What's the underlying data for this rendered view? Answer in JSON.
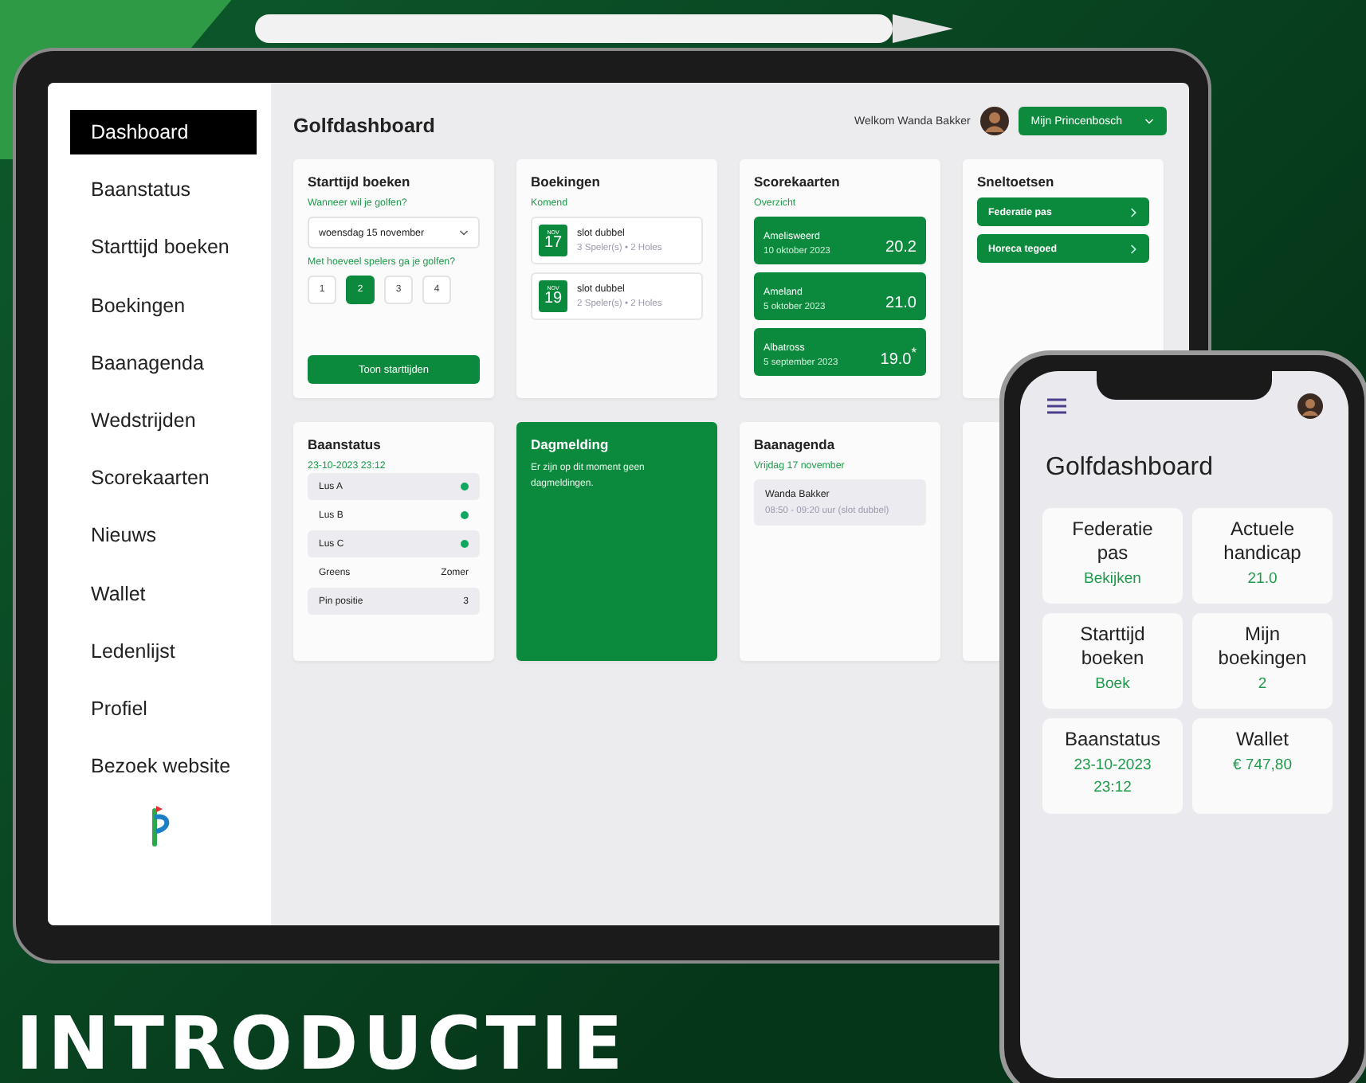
{
  "tablet": {
    "sidebar": {
      "items": [
        {
          "label": "Dashboard",
          "selected": true
        },
        {
          "label": "Baanstatus",
          "selected": false
        },
        {
          "label": "Starttijd boeken",
          "selected": false
        },
        {
          "label": "Boekingen",
          "selected": false
        },
        {
          "label": "Baanagenda",
          "selected": false
        },
        {
          "label": "Wedstrijden",
          "selected": false
        },
        {
          "label": "Scorekaarten",
          "selected": false
        },
        {
          "label": "Nieuws",
          "selected": false
        },
        {
          "label": "Wallet",
          "selected": false
        },
        {
          "label": "Ledenlijst",
          "selected": false
        },
        {
          "label": "Profiel",
          "selected": false
        },
        {
          "label": "Bezoek website",
          "selected": false
        }
      ]
    },
    "header": {
      "title": "Golfdashboard",
      "welcome": "Welkom Wanda Bakker",
      "club_button": "Mijn Princenbosch"
    },
    "starttijd": {
      "title": "Starttijd boeken",
      "question_date": "Wanneer wil je golfen?",
      "date_value": "woensdag 15 november",
      "question_players": "Met hoeveel spelers ga je golfen?",
      "players": [
        {
          "label": "1",
          "selected": false
        },
        {
          "label": "2",
          "selected": true
        },
        {
          "label": "3",
          "selected": false
        },
        {
          "label": "4",
          "selected": false
        }
      ],
      "button": "Toon starttijden"
    },
    "boekingen": {
      "title": "Boekingen",
      "subtitle": "Komend",
      "items": [
        {
          "month": "NOV",
          "day": "17",
          "name": "slot dubbel",
          "details": "3 Speler(s) • 2 Holes"
        },
        {
          "month": "NOV",
          "day": "19",
          "name": "slot dubbel",
          "details": "2 Speler(s) • 2 Holes"
        }
      ]
    },
    "scorekaarten": {
      "title": "Scorekaarten",
      "subtitle": "Overzicht",
      "items": [
        {
          "course": "Amelisweerd",
          "date": "10 oktober 2023",
          "score": "20.2"
        },
        {
          "course": "Ameland",
          "date": "5 oktober 2023",
          "score": "21.0"
        },
        {
          "course": "Albatross",
          "date": "5 september 2023",
          "score": "19.0$^{*}$"
        }
      ]
    },
    "sneltoetsen": {
      "title": "Sneltoetsen",
      "items": [
        "Federatie pas",
        "Horeca tegoed"
      ]
    },
    "baanstatus": {
      "title": "Baanstatus",
      "subtitle": "23-10-2023 23:12",
      "rows": [
        {
          "kind": "dot",
          "label": "Lus A",
          "color": "#10a860"
        },
        {
          "kind": "dot",
          "label": "Lus B",
          "color": "#10a860"
        },
        {
          "kind": "dot",
          "label": "Lus C",
          "color": "#10a860"
        },
        {
          "kind": "text",
          "label": "Greens",
          "value": "Zomer"
        },
        {
          "kind": "text",
          "label": "Pin positie",
          "value": "3"
        }
      ]
    },
    "dagmelding": {
      "title": "Dagmelding",
      "text": "Er zijn op dit moment geen dagmeldingen."
    },
    "baanagenda": {
      "title": "Baanagenda",
      "subtitle": "Vrijdag 17 november",
      "items": [
        {
          "name": "Wanda Bakker",
          "time": "08:50 - 09:20 uur (slot dubbel)"
        }
      ]
    }
  },
  "phone": {
    "title": "Golfdashboard",
    "tiles": [
      {
        "title": "Federatie pas",
        "lines": [
          "Bekijken"
        ]
      },
      {
        "title": "Actuele handicap",
        "lines": [
          "21.0"
        ]
      },
      {
        "title": "Starttijd boeken",
        "lines": [
          "Boek"
        ]
      },
      {
        "title": "Mijn boekingen",
        "lines": [
          "2"
        ]
      },
      {
        "title": "Baanstatus",
        "lines": [
          "23-10-2023",
          "23:12"
        ]
      },
      {
        "title": "Wallet",
        "lines": [
          "€ 747,80"
        ]
      }
    ]
  },
  "headline": "INTRODUCTIE"
}
